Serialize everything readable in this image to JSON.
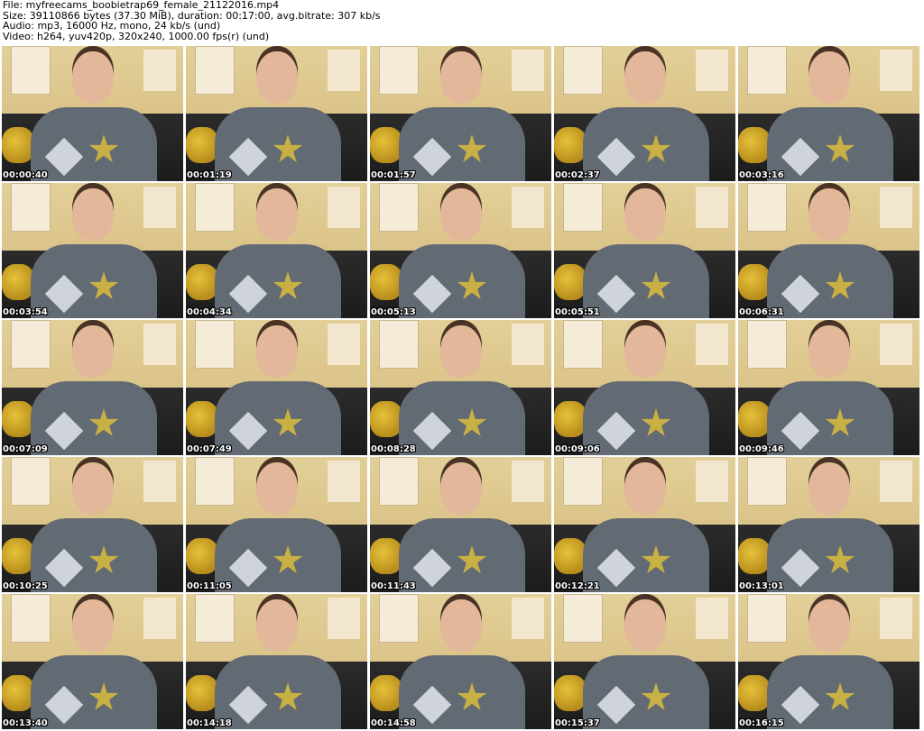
{
  "header": {
    "file_line": "File: myfreecams_boobietrap69_female_21122016.mp4",
    "size_line": "Size: 39110866 bytes (37.30 MiB), duration: 00:17:00, avg.bitrate: 307 kb/s",
    "audio_line": "Audio: mp3, 16000 Hz, mono, 24 kb/s (und)",
    "video_line": "Video: h264, yuv420p, 320x240, 1000.00 fps(r) (und)"
  },
  "thumbnails": [
    {
      "timestamp": "00:00:40"
    },
    {
      "timestamp": "00:01:19"
    },
    {
      "timestamp": "00:01:57"
    },
    {
      "timestamp": "00:02:37"
    },
    {
      "timestamp": "00:03:16"
    },
    {
      "timestamp": "00:03:54"
    },
    {
      "timestamp": "00:04:34"
    },
    {
      "timestamp": "00:05:13"
    },
    {
      "timestamp": "00:05:51"
    },
    {
      "timestamp": "00:06:31"
    },
    {
      "timestamp": "00:07:09"
    },
    {
      "timestamp": "00:07:49"
    },
    {
      "timestamp": "00:08:28"
    },
    {
      "timestamp": "00:09:06"
    },
    {
      "timestamp": "00:09:46"
    },
    {
      "timestamp": "00:10:25"
    },
    {
      "timestamp": "00:11:05"
    },
    {
      "timestamp": "00:11:43"
    },
    {
      "timestamp": "00:12:21"
    },
    {
      "timestamp": "00:13:01"
    },
    {
      "timestamp": "00:13:40"
    },
    {
      "timestamp": "00:14:18"
    },
    {
      "timestamp": "00:14:58"
    },
    {
      "timestamp": "00:15:37"
    },
    {
      "timestamp": "00:16:15"
    }
  ]
}
